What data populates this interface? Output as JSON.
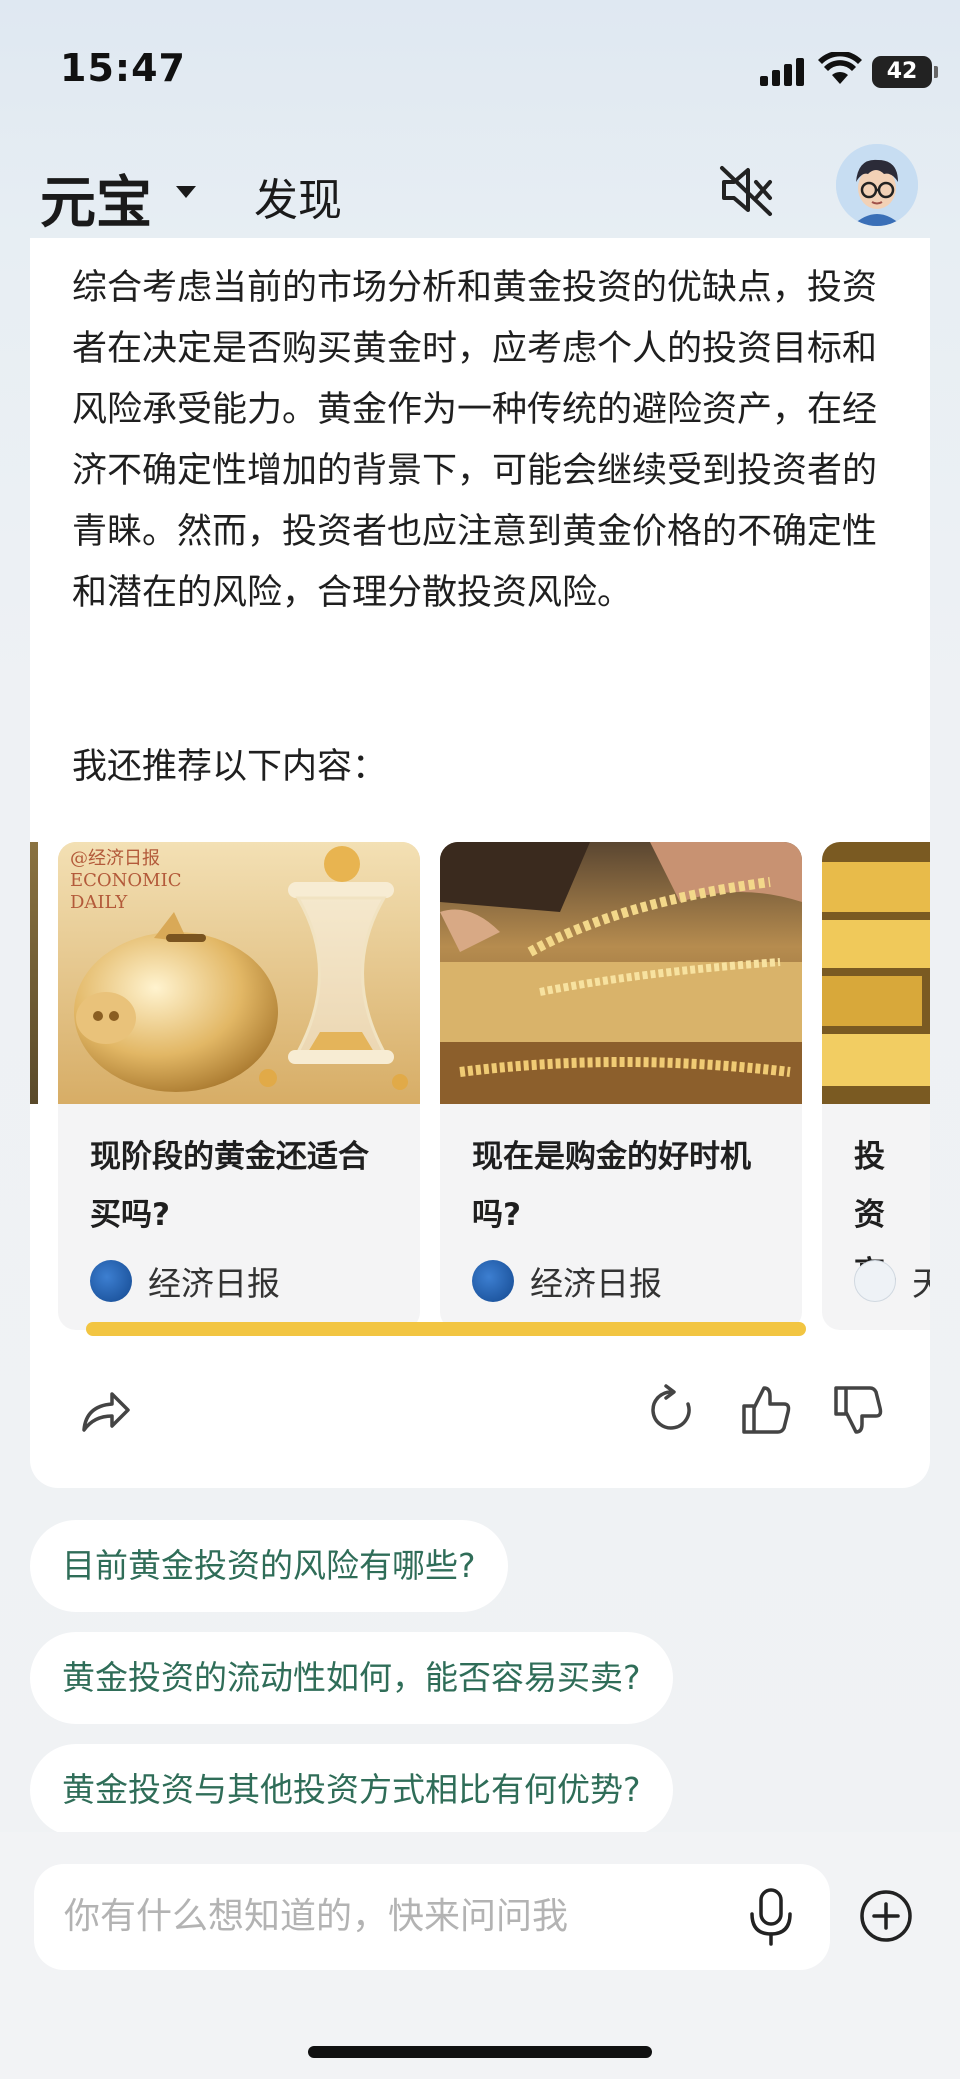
{
  "status_bar": {
    "time": "15:47",
    "battery": "42"
  },
  "header": {
    "app_title": "元宝",
    "discover_label": "发现"
  },
  "answer": {
    "paragraph": "综合考虑当前的市场分析和黄金投资的优缺点，投资者在决定是否购买黄金时，应考虑个人的投资目标和风险承受能力。黄金作为一种传统的避险资产，在经济不确定性增加的背景下，可能会继续受到投资者的青睐。然而，投资者也应注意到黄金价格的不确定性和潜在的风险，合理分散投资风险。",
    "recommend_title": "我还推荐以下内容："
  },
  "recommendations": [
    {
      "title": "现阶段的黄金还适合买吗?",
      "source": "经济日报",
      "image_caption": "@经济日报 ECONOMIC DAILY"
    },
    {
      "title": "现在是购金的好时机吗?",
      "source": "经济日报"
    },
    {
      "title": "投资高，",
      "source": "天"
    }
  ],
  "suggestions": [
    "目前黄金投资的风险有哪些?",
    "黄金投资的流动性如何，能否容易买卖?",
    "黄金投资与其他投资方式相比有何优势?"
  ],
  "input": {
    "placeholder": "你有什么想知道的，快来问问我"
  },
  "colors": {
    "chip_text": "#2f6d58",
    "highlight": "#f2c542",
    "card_bg": "#ffffff"
  }
}
